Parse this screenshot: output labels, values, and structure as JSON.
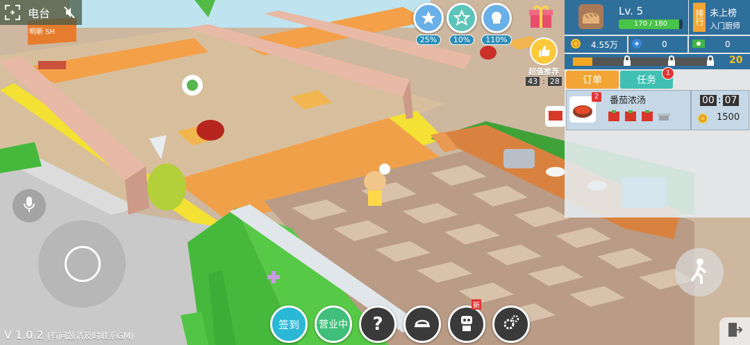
{
  "top_left": {
    "radio_label": "电台"
  },
  "buffs": [
    {
      "value": "25%",
      "color": "#6ab0e8"
    },
    {
      "value": "10%",
      "color": "#5cc4b8"
    },
    {
      "value": "110%",
      "color": "#6ab0e8"
    }
  ],
  "promo": {
    "label": "超值推荐",
    "time_min": "43",
    "time_sec": "28"
  },
  "player": {
    "level": "Lv. 5",
    "exp": "170 / 180",
    "exp_fraction": 0.944
  },
  "rank": {
    "title": "排行",
    "status": "未上榜",
    "rank_name": "入门厨师"
  },
  "resources": {
    "coins": "4.55万",
    "gems": "0",
    "cash": "0"
  },
  "progress": {
    "level_value": "20"
  },
  "tabs": {
    "orders": "订单",
    "tasks": "任务",
    "tasks_badge": "1"
  },
  "order": {
    "dish_name": "番茄浓汤",
    "count_badge": "2",
    "timer_min": "00",
    "timer_sec": "07",
    "reward": "1500"
  },
  "bottom": {
    "signin": "签到",
    "open": "营业中",
    "help": "?",
    "new_badge": "新"
  },
  "version": {
    "number": "V 1.0.2",
    "note": "(有问题请及时联系GM)"
  },
  "wall_sign": "明斯 SH"
}
